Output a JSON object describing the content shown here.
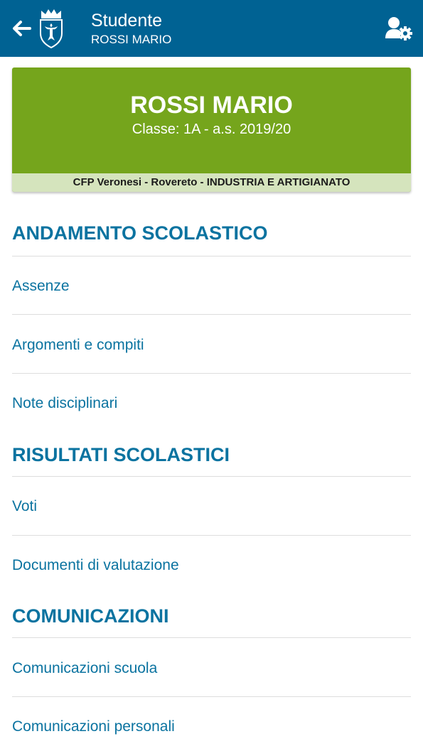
{
  "appbar": {
    "title": "Studente",
    "subtitle": "ROSSI MARIO",
    "back_icon": "arrow-left-icon",
    "logo_icon": "coat-of-arms-logo",
    "settings_icon": "user-settings-icon",
    "background_color": "#006293"
  },
  "student_card": {
    "name": "ROSSI MARIO",
    "class_info": "Classe: 1A - a.s. 2019/20",
    "school": "CFP Veronesi - Rovereto - INDUSTRIA E ARTIGIANATO",
    "background_color": "#75a51c",
    "footer_color": "#d5e4bd"
  },
  "sections": [
    {
      "title": "ANDAMENTO SCOLASTICO",
      "items": [
        "Assenze",
        "Argomenti e compiti",
        "Note disciplinari"
      ]
    },
    {
      "title": "RISULTATI SCOLASTICI",
      "items": [
        "Voti",
        "Documenti di valutazione"
      ]
    },
    {
      "title": "COMUNICAZIONI",
      "items": [
        "Comunicazioni scuola",
        "Comunicazioni personali"
      ]
    }
  ],
  "accent_color": "#0b73a0"
}
